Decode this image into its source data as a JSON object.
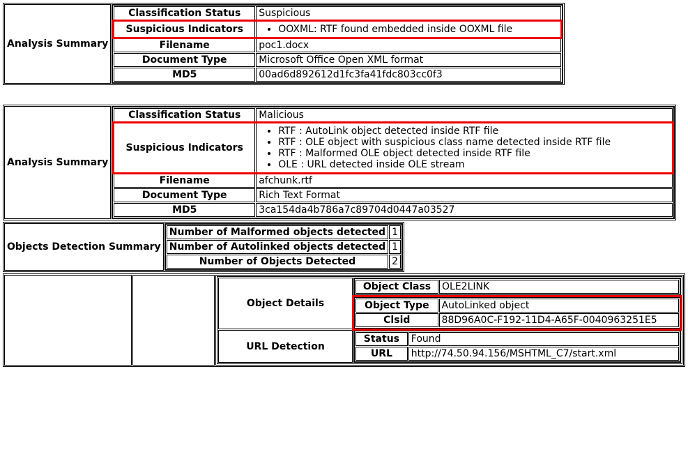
{
  "labels": {
    "analysis_summary": "Analysis Summary",
    "classification_status": "Classification Status",
    "suspicious_indicators": "Suspicious Indicators",
    "filename": "Filename",
    "document_type": "Document Type",
    "md5": "MD5",
    "objects_detection_summary": "Objects Detection Summary",
    "num_malformed": "Number of Malformed objects detected",
    "num_autolinked": "Number of Autolinked objects detected",
    "num_objects": "Number of Objects Detected",
    "object_details": "Object Details",
    "object_class": "Object Class",
    "object_type": "Object Type",
    "clsid": "Clsid",
    "url_detection": "URL Detection",
    "status": "Status",
    "url": "URL"
  },
  "block1": {
    "classification_status": "Suspicious",
    "indicators": [
      "OOXML: RTF found embedded inside OOXML file"
    ],
    "filename": "poc1.docx",
    "document_type": "Microsoft Office Open XML format",
    "md5": "00ad6d892612d1fc3fa41fdc803cc0f3"
  },
  "block2": {
    "classification_status": "Malicious",
    "indicators": [
      "RTF : AutoLink object detected inside RTF file",
      "RTF : OLE object with suspicious class name detected inside RTF file",
      "RTF : Malformed OLE object detected inside RTF file",
      "OLE : URL detected inside OLE stream"
    ],
    "filename": "afchunk.rtf",
    "document_type": "Rich Text Format",
    "md5": "3ca154da4b786a7c89704d0447a03527"
  },
  "objects_summary": {
    "malformed": "1",
    "autolinked": "1",
    "total": "2"
  },
  "object_detail": {
    "object_class": "OLE2LINK",
    "object_type": "AutoLinked object",
    "clsid": "88D96A0C-F192-11D4-A65F-0040963251E5",
    "url_status": "Found",
    "url": "http://74.50.94.156/MSHTML_C7/start.xml"
  }
}
